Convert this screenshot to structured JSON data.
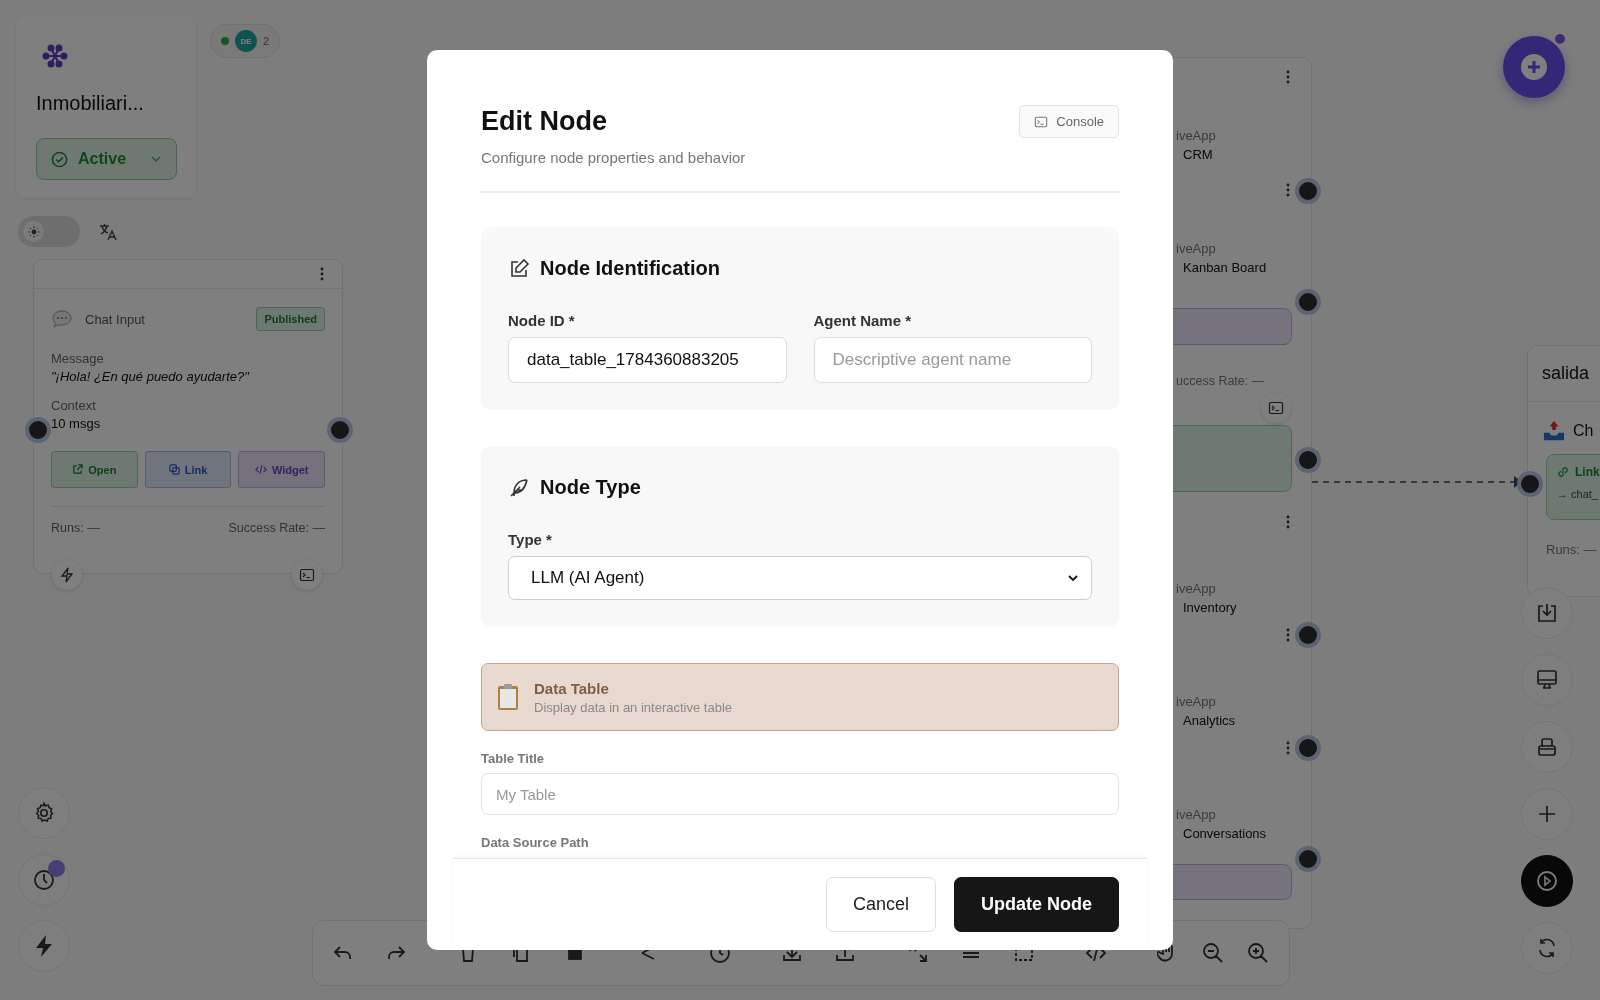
{
  "workspace": {
    "title": "Inmobiliari...",
    "status": "Active"
  },
  "presence": {
    "online": true,
    "initials": "DE",
    "count": "2"
  },
  "theme_toggle": {
    "dark": false
  },
  "chat_node": {
    "title": "Chat Input",
    "badge": "Published",
    "fields": [
      {
        "label": "Message",
        "value": "\"¡Hola! ¿En qué puedo ayudarte?\"",
        "kind": "quote"
      },
      {
        "label": "Context",
        "value": "10 msgs",
        "kind": "plain"
      }
    ],
    "actions": [
      {
        "label": "Open",
        "kind": "open"
      },
      {
        "label": "Link",
        "kind": "link"
      },
      {
        "label": "Widget",
        "kind": "widget"
      }
    ],
    "runs": "Runs: —",
    "success_rate": "Success Rate: —"
  },
  "background_nodes": [
    {
      "type": "iveApp",
      "name": "CRM"
    },
    {
      "type": "iveApp",
      "name": "Kanban Board"
    },
    {
      "type": "iveApp",
      "name": "Inventory"
    },
    {
      "type": "iveApp",
      "name": "Analytics"
    },
    {
      "type": "iveApp",
      "name": "Conversations"
    }
  ],
  "background_success_rate": "uccess Rate: —",
  "output_node": {
    "title": "salida",
    "item": "Ch",
    "link": "Link",
    "target": "→ chat_",
    "runs": "Runs: —"
  },
  "history_badge": true,
  "modal": {
    "title": "Edit Node",
    "subtitle": "Configure node properties and behavior",
    "console_button": "Console",
    "sections": [
      {
        "kind": "identification",
        "heading": "Node Identification",
        "fields": [
          {
            "label": "Node ID *",
            "value": "data_table_1784360883205",
            "kind": "text"
          },
          {
            "label": "Agent Name *",
            "placeholder": "Descriptive agent name",
            "kind": "text"
          }
        ]
      },
      {
        "kind": "type",
        "heading": "Node Type",
        "fields": [
          {
            "label": "Type *",
            "value": "LLM (AI Agent)",
            "kind": "select"
          }
        ]
      }
    ],
    "type_card": {
      "title": "Data Table",
      "description": "Display data in an interactive table"
    },
    "fields": [
      {
        "label": "Table Title",
        "placeholder": "My Table"
      },
      {
        "label": "Data Source Path"
      }
    ],
    "buttons": [
      {
        "label": "Cancel",
        "kind": "secondary"
      },
      {
        "label": "Update Node",
        "kind": "primary"
      }
    ]
  }
}
